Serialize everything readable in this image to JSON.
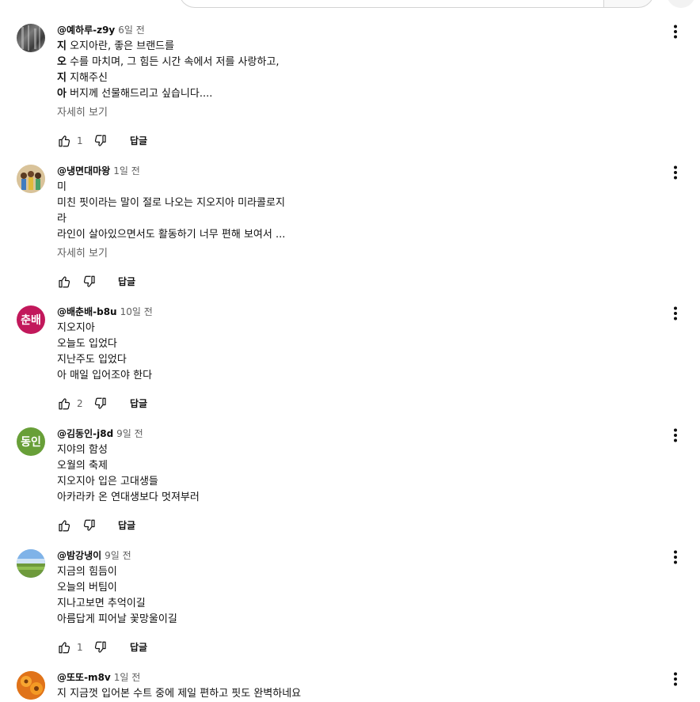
{
  "reply_label": "답글",
  "more_label": "자세히 보기",
  "comments": [
    {
      "author": "@예하루-z9y",
      "time": "6일 전",
      "lines": [
        {
          "bold": "지",
          "text": " 오지아란, 좋은 브랜드를"
        },
        {
          "bold": "오",
          "text": " 수를 마치며, 그 힘든 시간 속에서 저를 사랑하고,"
        },
        {
          "bold": "지",
          "text": " 지해주신"
        },
        {
          "bold": "아",
          "text": " 버지께 선물해드리고 싶습니다...."
        }
      ],
      "likes": "1",
      "avatar": {
        "type": "photo",
        "color": "#4a4a4a"
      }
    },
    {
      "author": "@냉면대마왕",
      "time": "1일 전",
      "lines": [
        {
          "bold": "",
          "text": "미"
        },
        {
          "bold": "",
          "text": "미친 핏이라는 말이 절로 나오는 지오지아 미라콜로지"
        },
        {
          "bold": "",
          "text": "라"
        },
        {
          "bold": "",
          "text": "라인이 살아있으면서도 활동하기 너무 편해 보여서 ..."
        }
      ],
      "likes": "",
      "avatar": {
        "type": "photo",
        "color": "#c9a46a"
      }
    },
    {
      "author": "@배춘배-b8u",
      "time": "10일 전",
      "lines": [
        {
          "bold": "",
          "text": "지오지아"
        },
        {
          "bold": "",
          "text": "오늘도 입었다"
        },
        {
          "bold": "",
          "text": "지난주도 입었다"
        },
        {
          "bold": "",
          "text": "아 매일 입어조야 한다"
        }
      ],
      "likes": "2",
      "avatar": {
        "type": "initials",
        "initials": "춘배",
        "color": "#c2185b"
      }
    },
    {
      "author": "@김동인-j8d",
      "time": "9일 전",
      "lines": [
        {
          "bold": "",
          "text": "지야의 함성"
        },
        {
          "bold": "",
          "text": "오월의 축제"
        },
        {
          "bold": "",
          "text": "지오지아 입은 고대생들"
        },
        {
          "bold": "",
          "text": "아카라카 온 연대생보다 멋져부러"
        }
      ],
      "likes": "",
      "avatar": {
        "type": "initials",
        "initials": "동인",
        "color": "#689f38"
      }
    },
    {
      "author": "@밤강냉이",
      "time": "9일 전",
      "lines": [
        {
          "bold": "",
          "text": "지금의 힘듬이"
        },
        {
          "bold": "",
          "text": "오늘의 버팀이"
        },
        {
          "bold": "",
          "text": "지나고보면 추억이길"
        },
        {
          "bold": "",
          "text": "아름답게 피어날 꽃망울이길"
        }
      ],
      "likes": "1",
      "avatar": {
        "type": "photo",
        "color": "#6f9fd8"
      }
    },
    {
      "author": "@또또-m8v",
      "time": "1일 전",
      "lines": [
        {
          "bold": "",
          "text": "지 지금껏 입어본 수트 중에 제일 편하고 핏도 완벽하네요"
        }
      ],
      "likes": "",
      "avatar": {
        "type": "photo",
        "color": "#f08a1c"
      }
    }
  ]
}
